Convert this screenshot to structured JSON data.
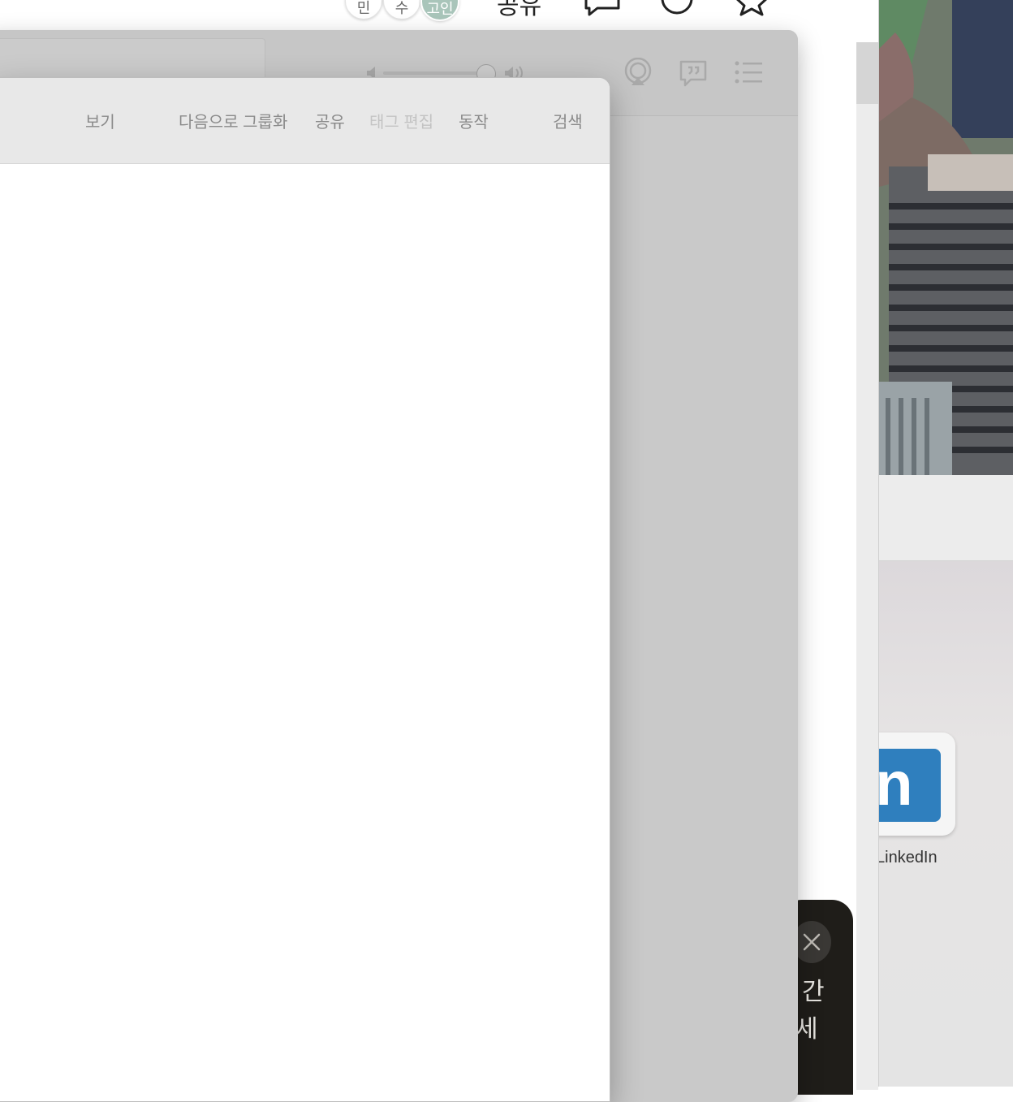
{
  "background_app": {
    "avatars": [
      "민",
      "수",
      "고인"
    ],
    "share_label": "공유"
  },
  "music_player": {
    "controls": [
      "volume-low-icon",
      "volume-slider",
      "volume-high-icon",
      "airplay-icon",
      "lyrics-icon",
      "queue-icon"
    ]
  },
  "finder_toolbar": {
    "items": [
      {
        "label": "보기",
        "enabled": true
      },
      {
        "label": "다음으로 그룹화",
        "enabled": true
      },
      {
        "label": "공유",
        "enabled": true
      },
      {
        "label": "태그 편집",
        "enabled": false
      },
      {
        "label": "동작",
        "enabled": true
      },
      {
        "label": "검색",
        "enabled": true
      }
    ]
  },
  "right_page": {
    "app_tile_label": "LinkedIn",
    "app_tile_glyph": "in",
    "brand_color": "#2f7fbe"
  },
  "toast": {
    "lines": [
      "간",
      "세"
    ]
  }
}
